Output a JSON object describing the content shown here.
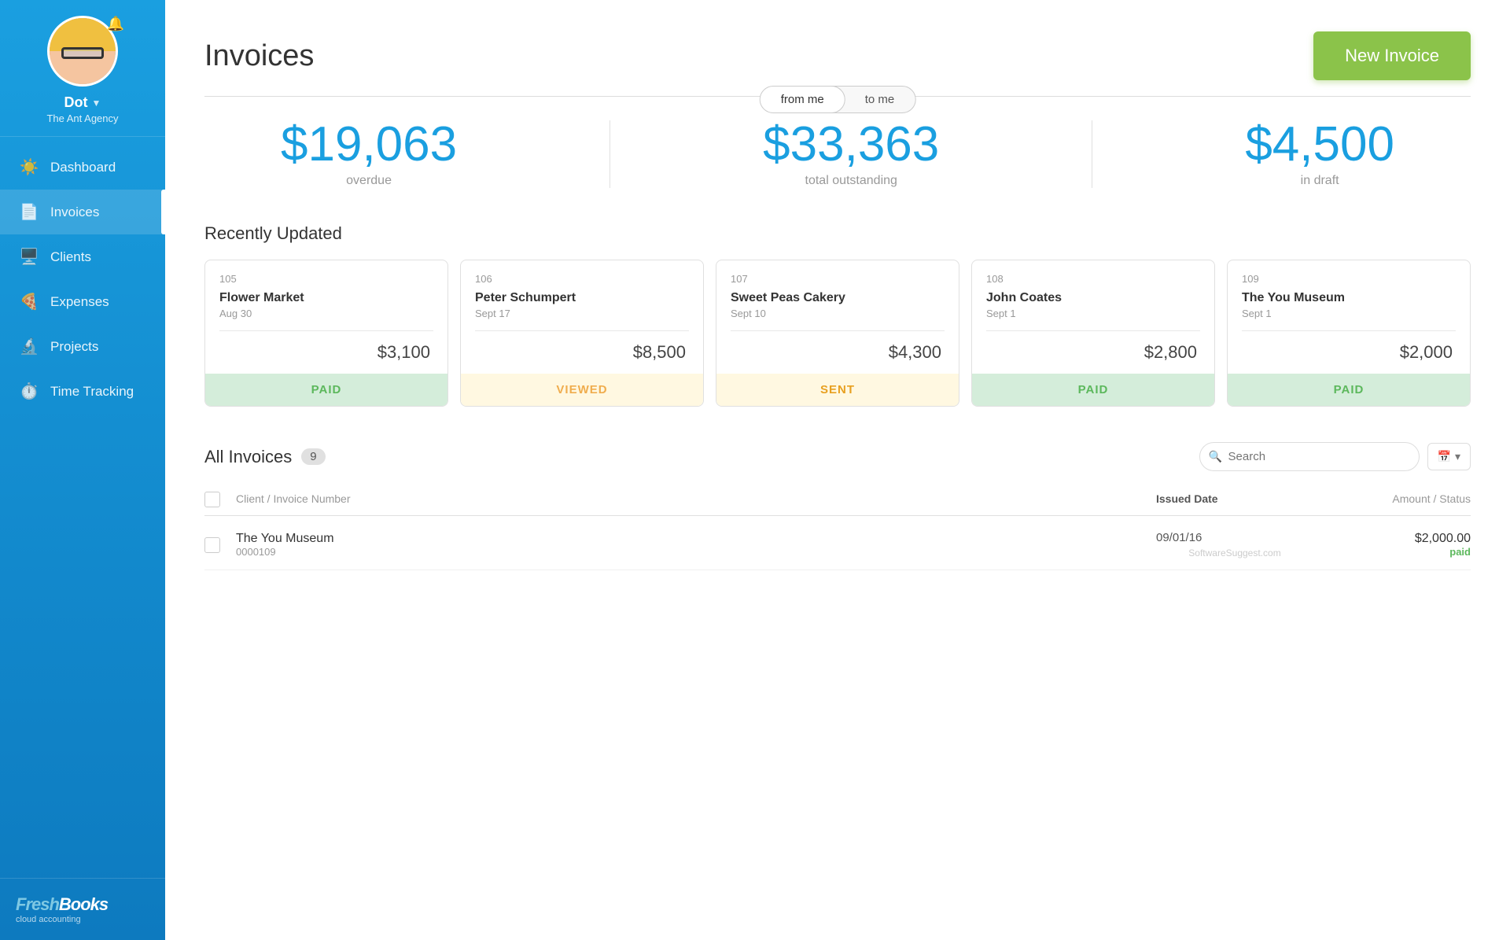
{
  "sidebar": {
    "user": {
      "name": "Dot",
      "agency": "The Ant Agency"
    },
    "nav_items": [
      {
        "id": "dashboard",
        "label": "Dashboard",
        "icon": "☀",
        "active": false
      },
      {
        "id": "invoices",
        "label": "Invoices",
        "icon": "📋",
        "active": true
      },
      {
        "id": "clients",
        "label": "Clients",
        "icon": "🖥",
        "active": false
      },
      {
        "id": "expenses",
        "label": "Expenses",
        "icon": "🍕",
        "active": false
      },
      {
        "id": "projects",
        "label": "Projects",
        "icon": "🔬",
        "active": false
      },
      {
        "id": "time_tracking",
        "label": "Time Tracking",
        "icon": "⏱",
        "active": false
      }
    ],
    "logo": {
      "brand": "FreshBooks",
      "sub": "cloud accounting"
    }
  },
  "header": {
    "title": "Invoices",
    "new_invoice_btn": "New Invoice"
  },
  "toggle": {
    "from_me": "from me",
    "to_me": "to me",
    "active": "from me"
  },
  "stats": [
    {
      "value": "$19,063",
      "label": "overdue"
    },
    {
      "value": "$33,363",
      "label": "total outstanding"
    },
    {
      "value": "$4,500",
      "label": "in draft"
    }
  ],
  "recently_updated": {
    "title": "Recently Updated",
    "cards": [
      {
        "number": "105",
        "client": "Flower Market",
        "date": "Aug 30",
        "amount": "$3,100",
        "status": "PAID",
        "status_type": "paid"
      },
      {
        "number": "106",
        "client": "Peter Schumpert",
        "date": "Sept 17",
        "amount": "$8,500",
        "status": "VIEWED",
        "status_type": "viewed"
      },
      {
        "number": "107",
        "client": "Sweet Peas Cakery",
        "date": "Sept 10",
        "amount": "$4,300",
        "status": "SENT",
        "status_type": "sent"
      },
      {
        "number": "108",
        "client": "John Coates",
        "date": "Sept 1",
        "amount": "$2,800",
        "status": "PAID",
        "status_type": "paid"
      },
      {
        "number": "109",
        "client": "The You Museum",
        "date": "Sept 1",
        "amount": "$2,000",
        "status": "PAID",
        "status_type": "paid"
      }
    ]
  },
  "all_invoices": {
    "title": "All Invoices",
    "count": "9",
    "search_placeholder": "Search",
    "columns": {
      "client_invoice": "Client / Invoice Number",
      "issued_date": "Issued Date",
      "amount_status": "Amount / Status"
    },
    "rows": [
      {
        "client": "The You Museum",
        "number": "0000109",
        "date": "09/01/16",
        "amount": "$2,000.00",
        "status": "paid"
      }
    ],
    "watermark": "SoftwareSuggest.com"
  }
}
